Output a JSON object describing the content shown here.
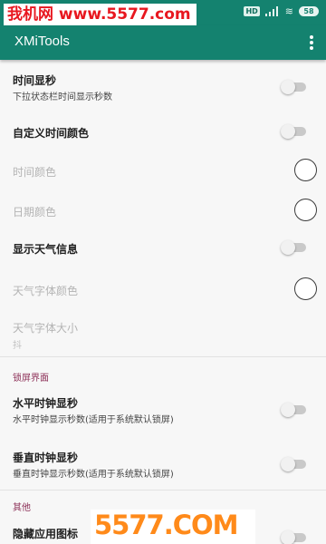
{
  "status_bar": {
    "watermark": "我机网 www.5577.com",
    "hd": "HD",
    "signal": "4G",
    "wifi": "≋",
    "battery": "58"
  },
  "toolbar": {
    "title": "XMiTools"
  },
  "prefs": {
    "time_seconds": {
      "title": "时间显秒",
      "summary": "下拉状态栏时间显示秒数"
    },
    "custom_time_color": {
      "title": "自定义时间颜色"
    },
    "time_color": {
      "title": "时间颜色"
    },
    "date_color": {
      "title": "日期颜色"
    },
    "show_weather": {
      "title": "显示天气信息"
    },
    "weather_font_color": {
      "title": "天气字体颜色"
    },
    "weather_font_size": {
      "title": "天气字体大小",
      "summary": "抖"
    }
  },
  "lockscreen": {
    "category": "锁屏界面",
    "horizontal_clock": {
      "title": "水平时钟显秒",
      "summary": "水平时钟显示秒数(适用于系统默认锁屏)"
    },
    "vertical_clock": {
      "title": "垂直时钟显秒",
      "summary": "垂直时钟显示秒数(适用于系统默认锁屏)"
    }
  },
  "other": {
    "category": "其他",
    "hide_app_icon": {
      "title": "隐藏应用图标"
    }
  },
  "bottom_watermark": "5577.COM",
  "colors": {
    "primary": "#14826f",
    "category": "#8c2f57",
    "watermark_red": "#e8171f",
    "watermark_orange": "#ff8a1a"
  }
}
